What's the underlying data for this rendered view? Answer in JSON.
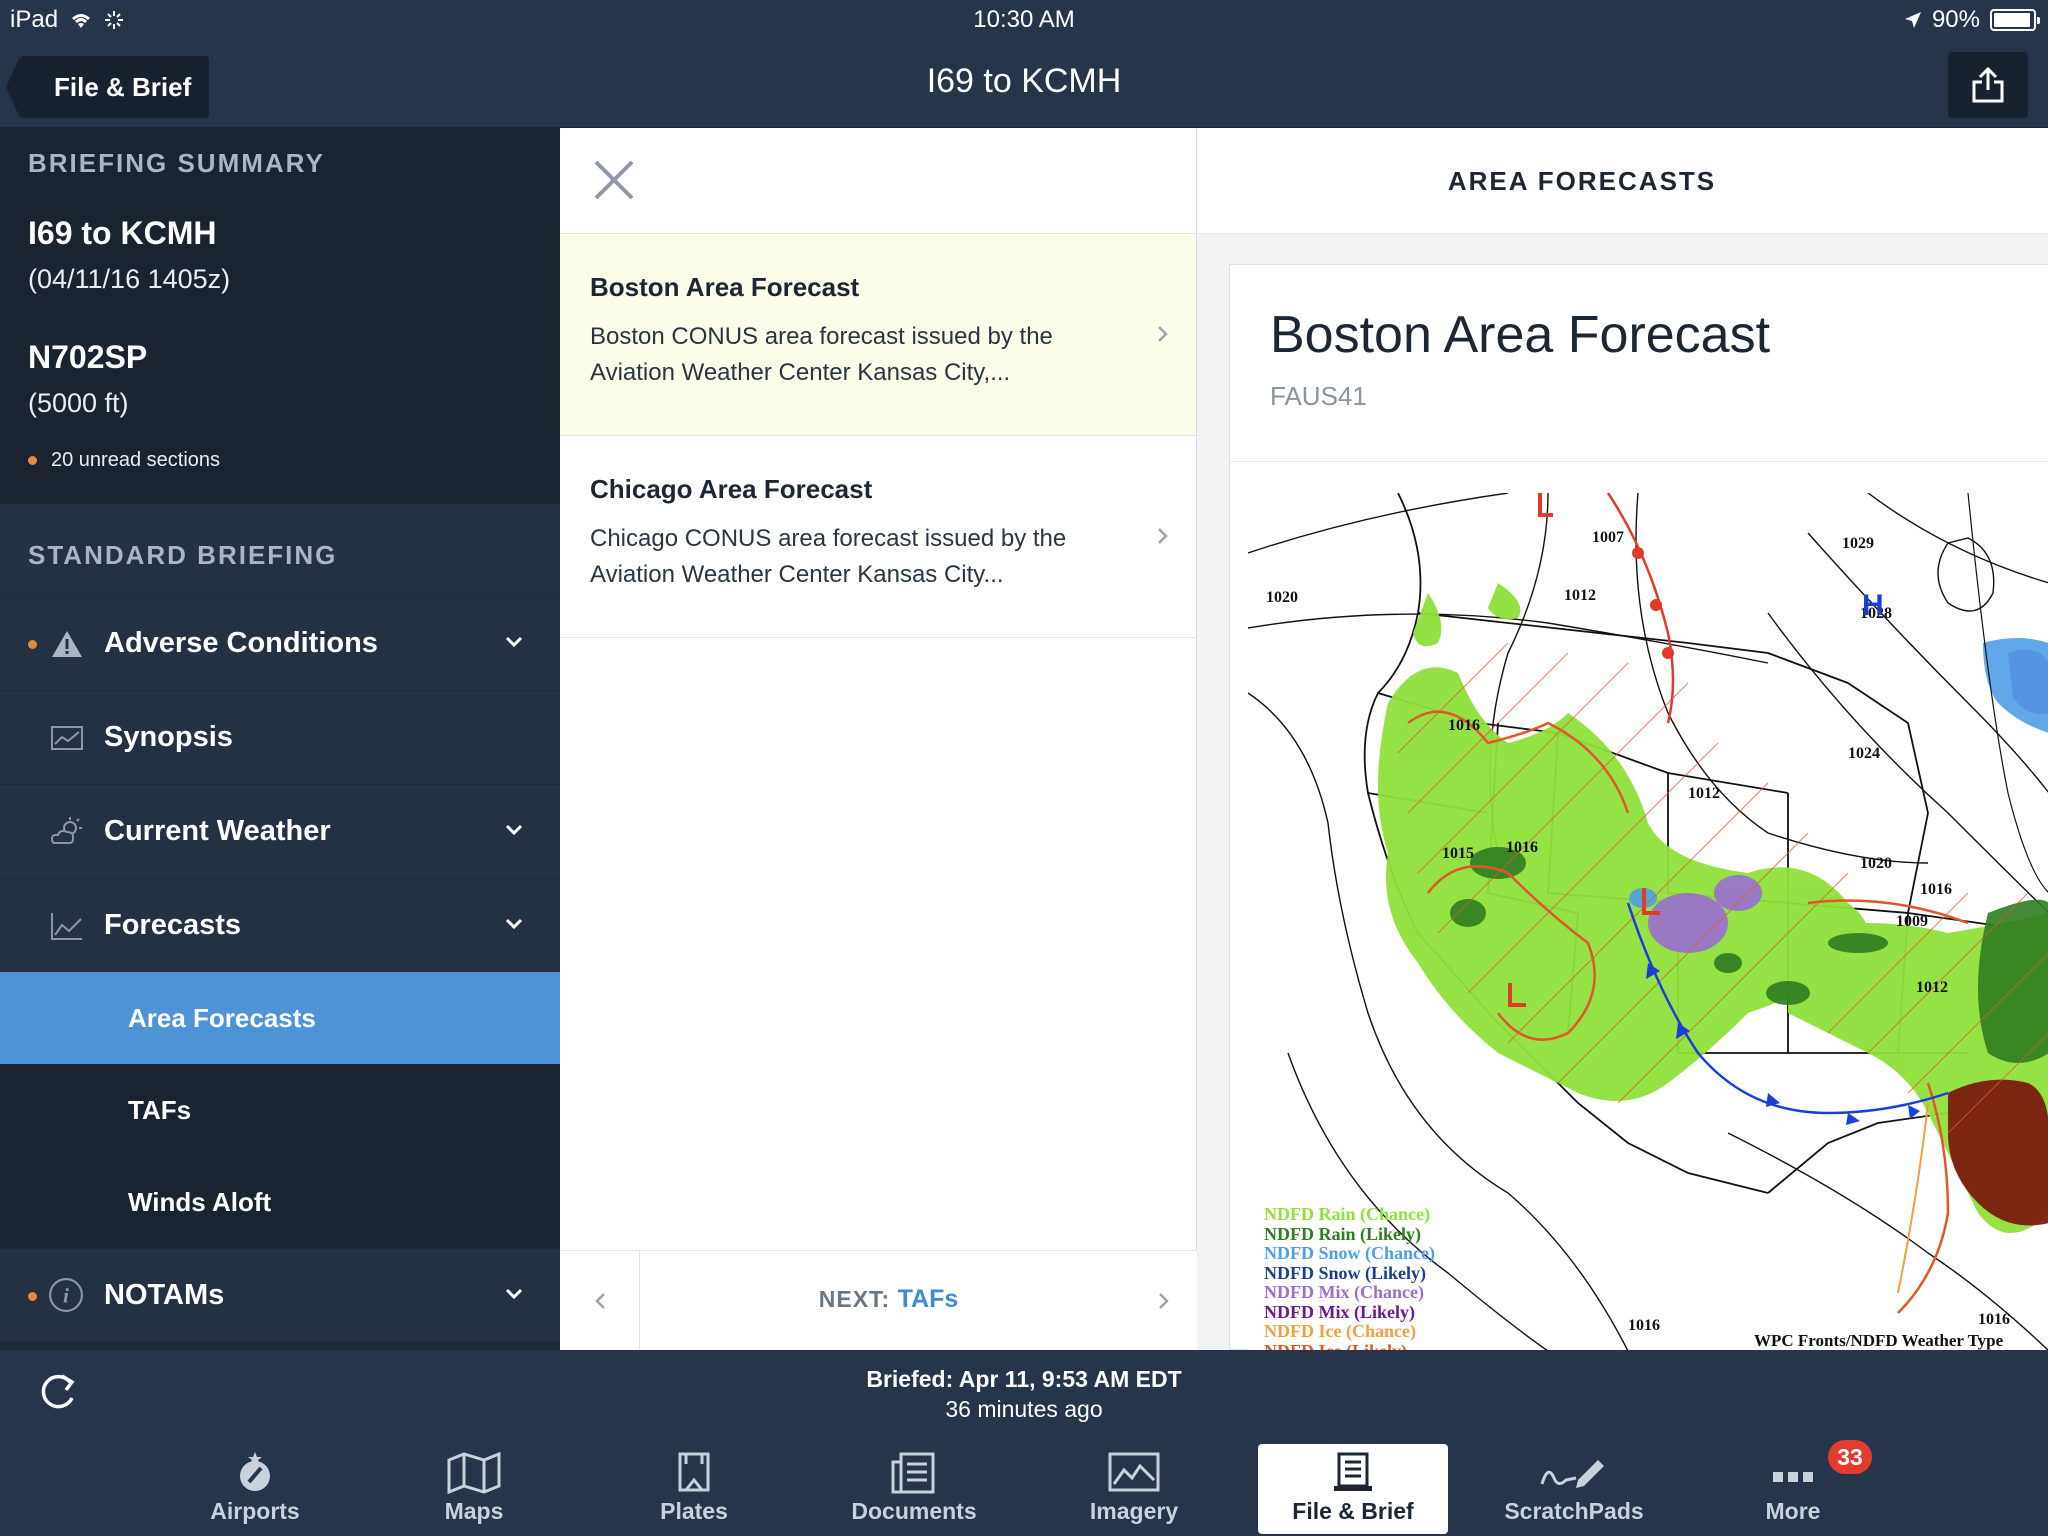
{
  "status_bar": {
    "device": "iPad",
    "time": "10:30 AM",
    "battery": "90%",
    "battery_level": 0.9
  },
  "nav": {
    "back_label": "File & Brief",
    "title": "I69 to KCMH"
  },
  "sidebar": {
    "summary_heading": "BRIEFING SUMMARY",
    "route": "I69 to KCMH",
    "route_time": "(04/11/16 1405z)",
    "tail_number": "N702SP",
    "altitude": "(5000 ft)",
    "unread": "20 unread sections",
    "standard_heading": "STANDARD BRIEFING",
    "items": {
      "adverse": "Adverse Conditions",
      "synopsis": "Synopsis",
      "current_weather": "Current Weather",
      "forecasts": "Forecasts",
      "notams": "NOTAMs"
    },
    "forecast_subitems": {
      "area": "Area Forecasts",
      "tafs": "TAFs",
      "winds": "Winds Aloft"
    }
  },
  "middle": {
    "items": [
      {
        "title": "Boston Area Forecast",
        "desc": "Boston CONUS area forecast issued by the Aviation Weather Center Kansas City,..."
      },
      {
        "title": "Chicago Area Forecast",
        "desc": "Chicago CONUS area forecast issued by the Aviation Weather Center Kansas City..."
      }
    ],
    "next_prefix": "NEXT:",
    "next_link": "TAFs"
  },
  "detail": {
    "header": "AREA FORECASTS",
    "title": "Boston Area Forecast",
    "code": "FAUS41",
    "map": {
      "isobars": {
        "a": "1007",
        "b": "1029",
        "c": "1020",
        "d": "1012",
        "e": "1028",
        "f": "1016",
        "g": "1024",
        "h": "1012",
        "i": "1015",
        "j": "1016",
        "k": "1020",
        "l": "1016",
        "m": "1009",
        "n": "1012",
        "o": "1016",
        "p": "1016"
      },
      "high_label": "H",
      "legend": [
        {
          "text": "NDFD Rain (Chance)",
          "color": "#8ee03a"
        },
        {
          "text": "NDFD Rain (Likely)",
          "color": "#2e7d20"
        },
        {
          "text": "NDFD Snow (Chance)",
          "color": "#4f9ee8"
        },
        {
          "text": "NDFD Snow (Likely)",
          "color": "#1c3e8a"
        },
        {
          "text": "NDFD Mix (Chance)",
          "color": "#9a6fd0"
        },
        {
          "text": "NDFD Mix (Likely)",
          "color": "#6a1a8a"
        },
        {
          "text": "NDFD Ice (Chance)",
          "color": "#f0a040"
        },
        {
          "text": "NDFD Ice (Likely)",
          "color": "#e0582a"
        }
      ],
      "caption": "WPC Fronts/NDFD Weather Type"
    }
  },
  "briefed": {
    "text": "Briefed: Apr 11, 9:53 AM EDT",
    "ago": "36 minutes ago"
  },
  "tabs": {
    "airports": "Airports",
    "maps": "Maps",
    "plates": "Plates",
    "documents": "Documents",
    "imagery": "Imagery",
    "file_brief": "File & Brief",
    "scratchpads": "ScratchPads",
    "more": "More",
    "more_badge": "33"
  },
  "colors": {
    "accent": "#4e93d6",
    "unread_dot": "#e68a3a",
    "badge": "#e43b30"
  }
}
